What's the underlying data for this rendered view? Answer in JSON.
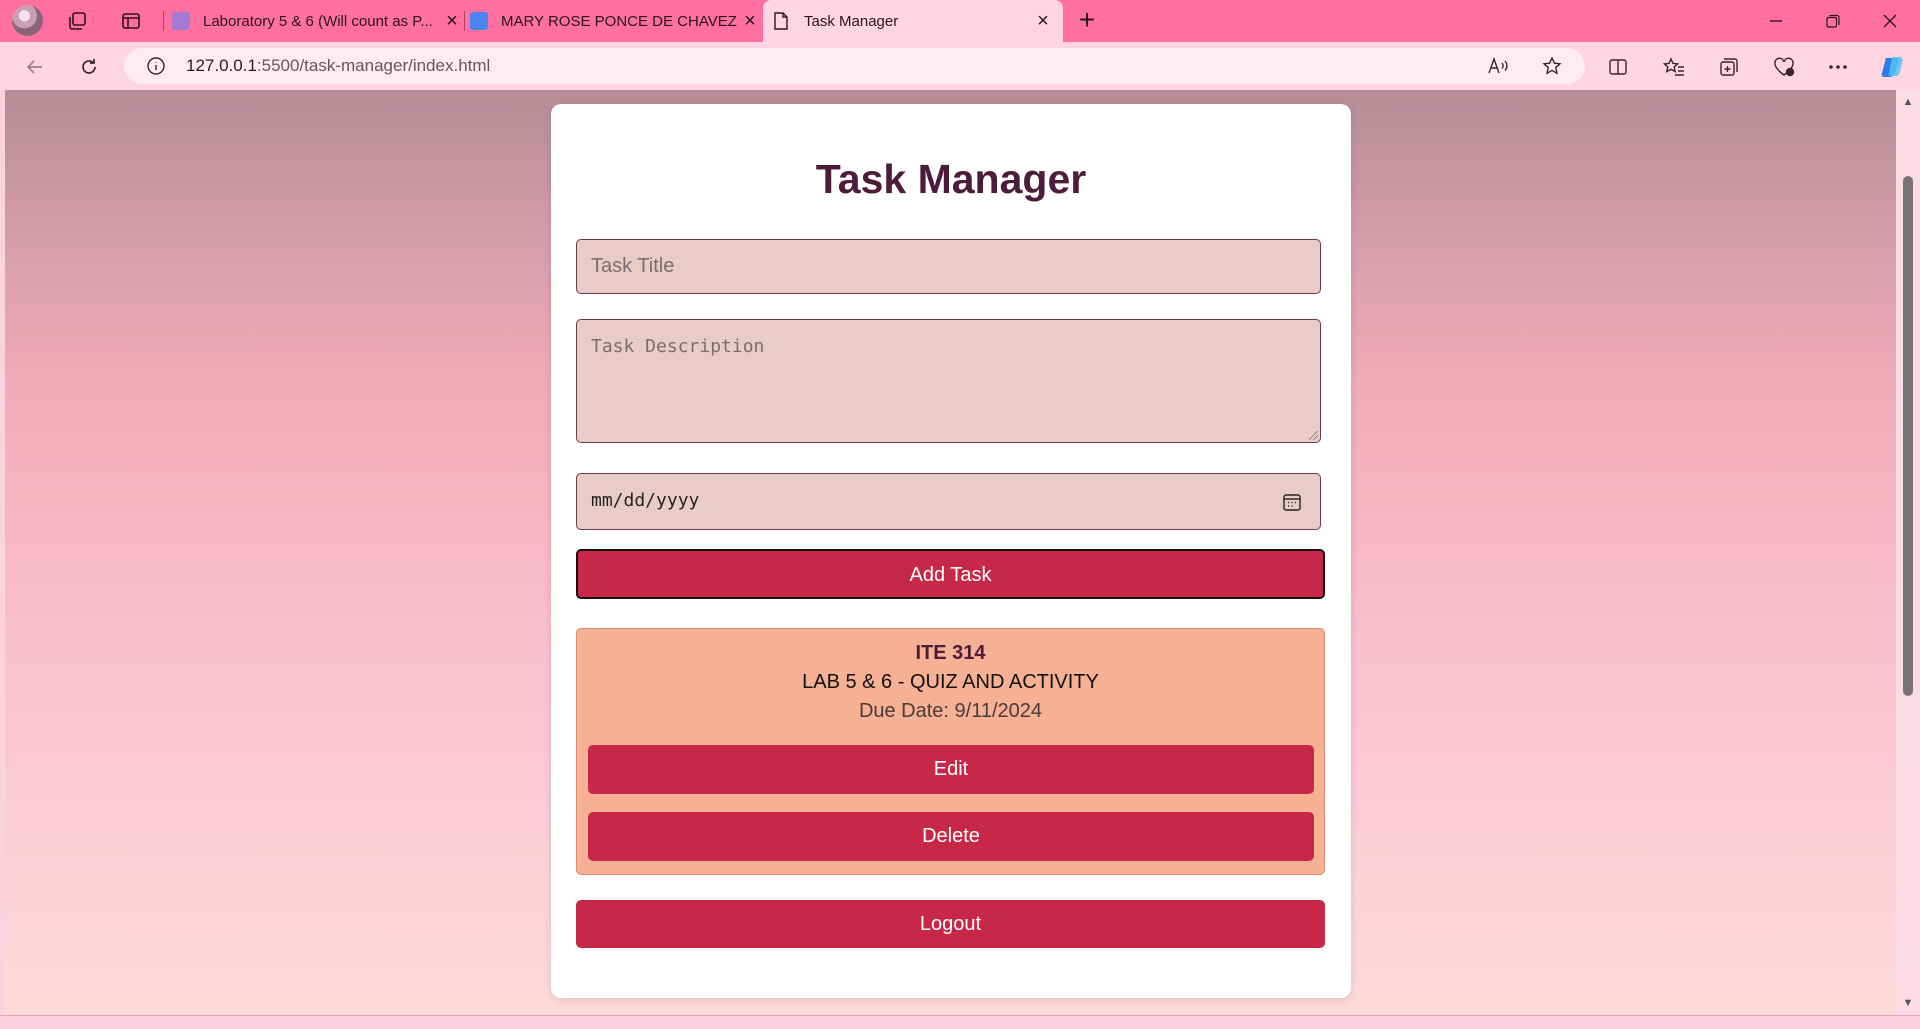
{
  "browser": {
    "tabs": [
      {
        "label": "Laboratory 5 & 6 (Will count as P...",
        "favicon": "classroom-icon",
        "favicon_color": "#a37bd4"
      },
      {
        "label": "MARY ROSE PONCE DE CHAVEZ - ...",
        "favicon": "docs-icon",
        "favicon_color": "#4a86f0"
      },
      {
        "label": "Task Manager",
        "favicon": "page-icon",
        "favicon_color": "#ffffff"
      }
    ],
    "url_host": "127.0.0.1",
    "url_rest": ":5500/task-manager/index.html",
    "theme_color": "#ff6f9f"
  },
  "page": {
    "title": "Task Manager",
    "title_placeholder": "Task Title",
    "description_placeholder": "Task Description",
    "date_placeholder": "mm/dd/yyyy",
    "add_button": "Add Task",
    "logout_button": "Logout",
    "accent_color": "#c82848",
    "task_bg_color": "#f6b093"
  },
  "tasks": [
    {
      "name": "ITE 314",
      "description": "LAB 5 & 6 - QUIZ AND ACTIVITY",
      "due": "Due Date: 9/11/2024",
      "edit_label": "Edit",
      "delete_label": "Delete"
    }
  ]
}
